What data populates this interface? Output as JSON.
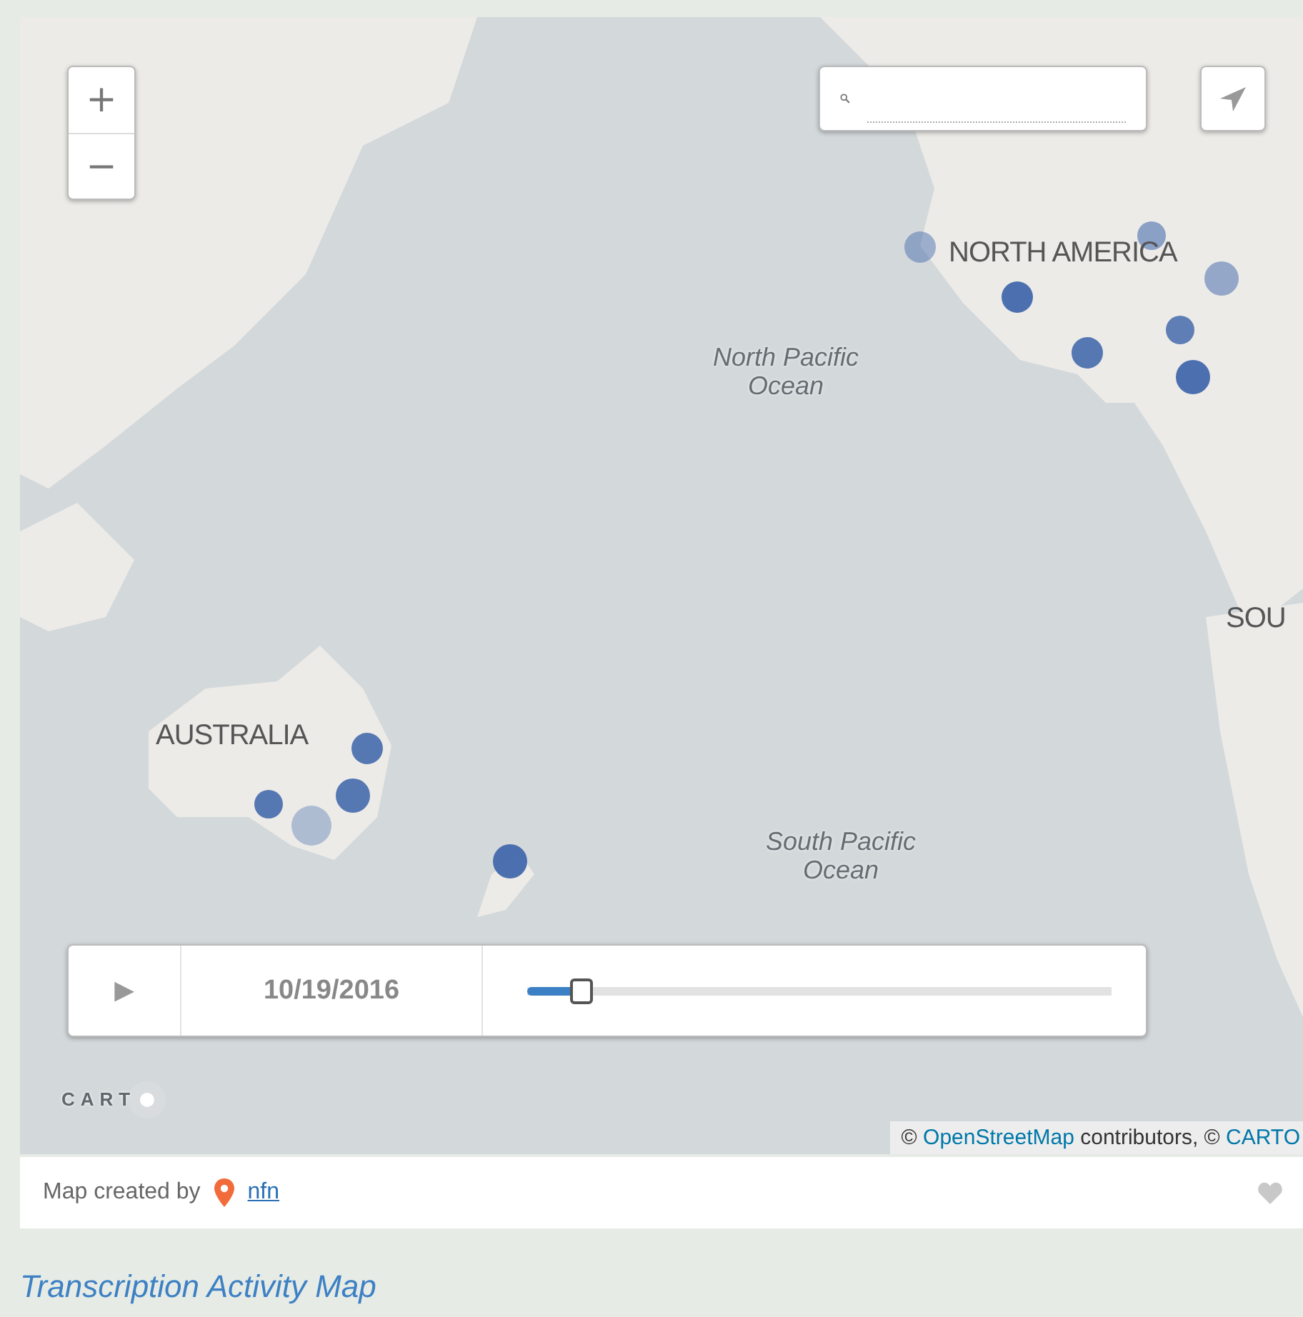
{
  "map": {
    "zoom_controls": {
      "zoom_in": "+",
      "zoom_out": "−"
    },
    "labels": [
      {
        "text": "NORTH AMERICA",
        "kind": "continent"
      },
      {
        "text": "North Pacific\nOcean",
        "kind": "ocean"
      },
      {
        "text": "SOU",
        "kind": "continent"
      },
      {
        "text": "AUSTRALIA",
        "kind": "continent"
      },
      {
        "text": "South Pacific\nOcean",
        "kind": "ocean"
      }
    ],
    "timeline": {
      "play": "▶",
      "date": "10/19/2016",
      "level": 0.083
    },
    "logo": "CART",
    "attribution": [
      {
        "text": "© ",
        "kind": "plain"
      },
      {
        "text": "OpenStreetMap",
        "kind": "link"
      },
      {
        "text": " contributors, © ",
        "kind": "plain"
      },
      {
        "text": "CARTO",
        "kind": "link"
      }
    ]
  },
  "footer": {
    "created_by": "Map created by",
    "author": "nfn"
  },
  "title": "Transcription Activity Map"
}
